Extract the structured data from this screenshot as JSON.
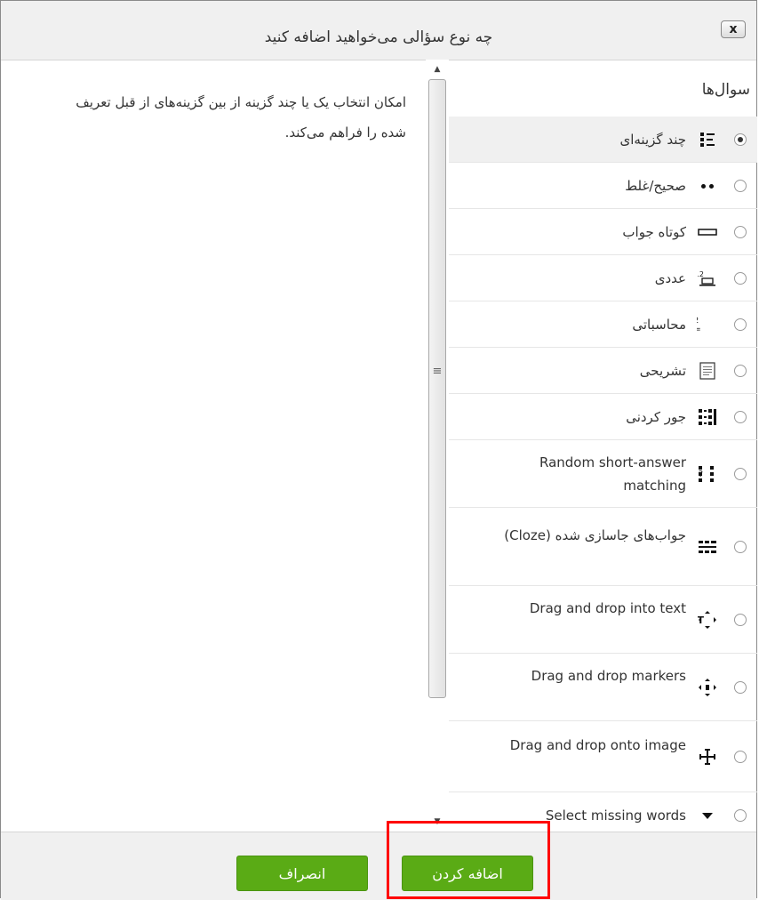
{
  "dialog": {
    "title": "چه نوع سؤالی می‌خواهید اضافه کنید",
    "close_label": "x"
  },
  "description": "امکان انتخاب یک یا چند گزینه از بین گزینه‌های از قبل تعریف شده را فراهم می‌کند.",
  "question_list": {
    "header": "سوال‌ها",
    "items": [
      {
        "label": "چند گزینه‌ای",
        "icon": "multichoice-icon",
        "selected": true
      },
      {
        "label": "صحیح/غلط",
        "icon": "truefalse-icon",
        "selected": false
      },
      {
        "label": "کوتاه جواب",
        "icon": "shortanswer-icon",
        "selected": false
      },
      {
        "label": "عددی",
        "icon": "numerical-icon",
        "selected": false
      },
      {
        "label": "محاسباتی",
        "icon": "calculated-icon",
        "selected": false
      },
      {
        "label": "تشریحی",
        "icon": "essay-icon",
        "selected": false
      },
      {
        "label": "جور کردنی",
        "icon": "matching-icon",
        "selected": false
      },
      {
        "label": "Random short-answer matching",
        "icon": "random-matching-icon",
        "selected": false
      },
      {
        "label": "جواب‌های جاسازی شده (Cloze)",
        "icon": "cloze-icon",
        "selected": false
      },
      {
        "label": "Drag and drop into text",
        "icon": "ddwtos-icon",
        "selected": false
      },
      {
        "label": "Drag and drop markers",
        "icon": "ddmarker-icon",
        "selected": false
      },
      {
        "label": "Drag and drop onto image",
        "icon": "ddimage-icon",
        "selected": false
      },
      {
        "label": "Select missing words",
        "icon": "select-missing-icon",
        "selected": false
      }
    ]
  },
  "footer": {
    "add_label": "اضافه کردن",
    "cancel_label": "انصراف"
  },
  "colors": {
    "button_green": "#5aab15",
    "highlight_red": "#ff0000"
  }
}
